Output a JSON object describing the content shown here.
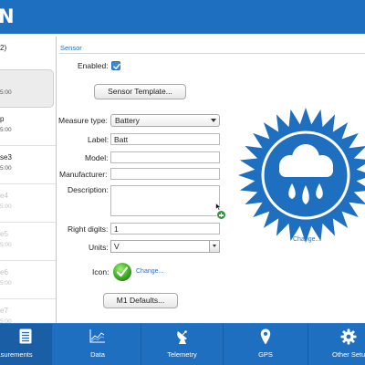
{
  "app": {
    "title": "N"
  },
  "sidebar": {
    "heading": "2)",
    "devices": [
      {
        "name": "",
        "time": "5:00",
        "state": "selected"
      },
      {
        "name": "p",
        "time": "5:00",
        "state": "normal"
      },
      {
        "name": "se3",
        "time": "5:00",
        "state": "normal"
      },
      {
        "name": "e4",
        "time": "5:00",
        "state": "inactive"
      },
      {
        "name": "e5",
        "time": "5:00",
        "state": "inactive"
      },
      {
        "name": "e6",
        "time": "5:00",
        "state": "inactive"
      },
      {
        "name": "e7",
        "time": "5:00",
        "state": "inactive"
      }
    ]
  },
  "sensor": {
    "section_title": "Sensor",
    "enabled_label": "Enabled:",
    "enabled_checked": true,
    "template_button": "Sensor Template...",
    "measure_type_label": "Measure type:",
    "measure_type_value": "Battery",
    "label_label": "Label:",
    "label_value": "Batt",
    "model_label": "Model:",
    "model_value": "",
    "manufacturer_label": "Manufacturer:",
    "manufacturer_value": "",
    "description_label": "Description:",
    "description_value": "",
    "right_digits_label": "Right digits:",
    "right_digits_value": "1",
    "units_label": "Units:",
    "units_value": "V",
    "icon_label": "Icon:",
    "icon_change_link": "Change...",
    "defaults_button": "M1 Defaults...",
    "image_change_link": "Change...",
    "image_icon": "rain-cloud-badge-icon"
  },
  "tabs": [
    {
      "label": "Measurements",
      "icon": "list-icon",
      "active": true
    },
    {
      "label": "Data",
      "icon": "chart-icon",
      "active": false
    },
    {
      "label": "Telemetry",
      "icon": "satellite-dish-icon",
      "active": false
    },
    {
      "label": "GPS",
      "icon": "map-pin-icon",
      "active": false
    },
    {
      "label": "Other Setup",
      "icon": "gear-icon",
      "active": false
    }
  ],
  "colors": {
    "brand_blue": "#1f6fc0",
    "badge_blue": "#1f6fc0",
    "accent_green": "#2e9c3a",
    "link_blue": "#2f6fb5"
  }
}
